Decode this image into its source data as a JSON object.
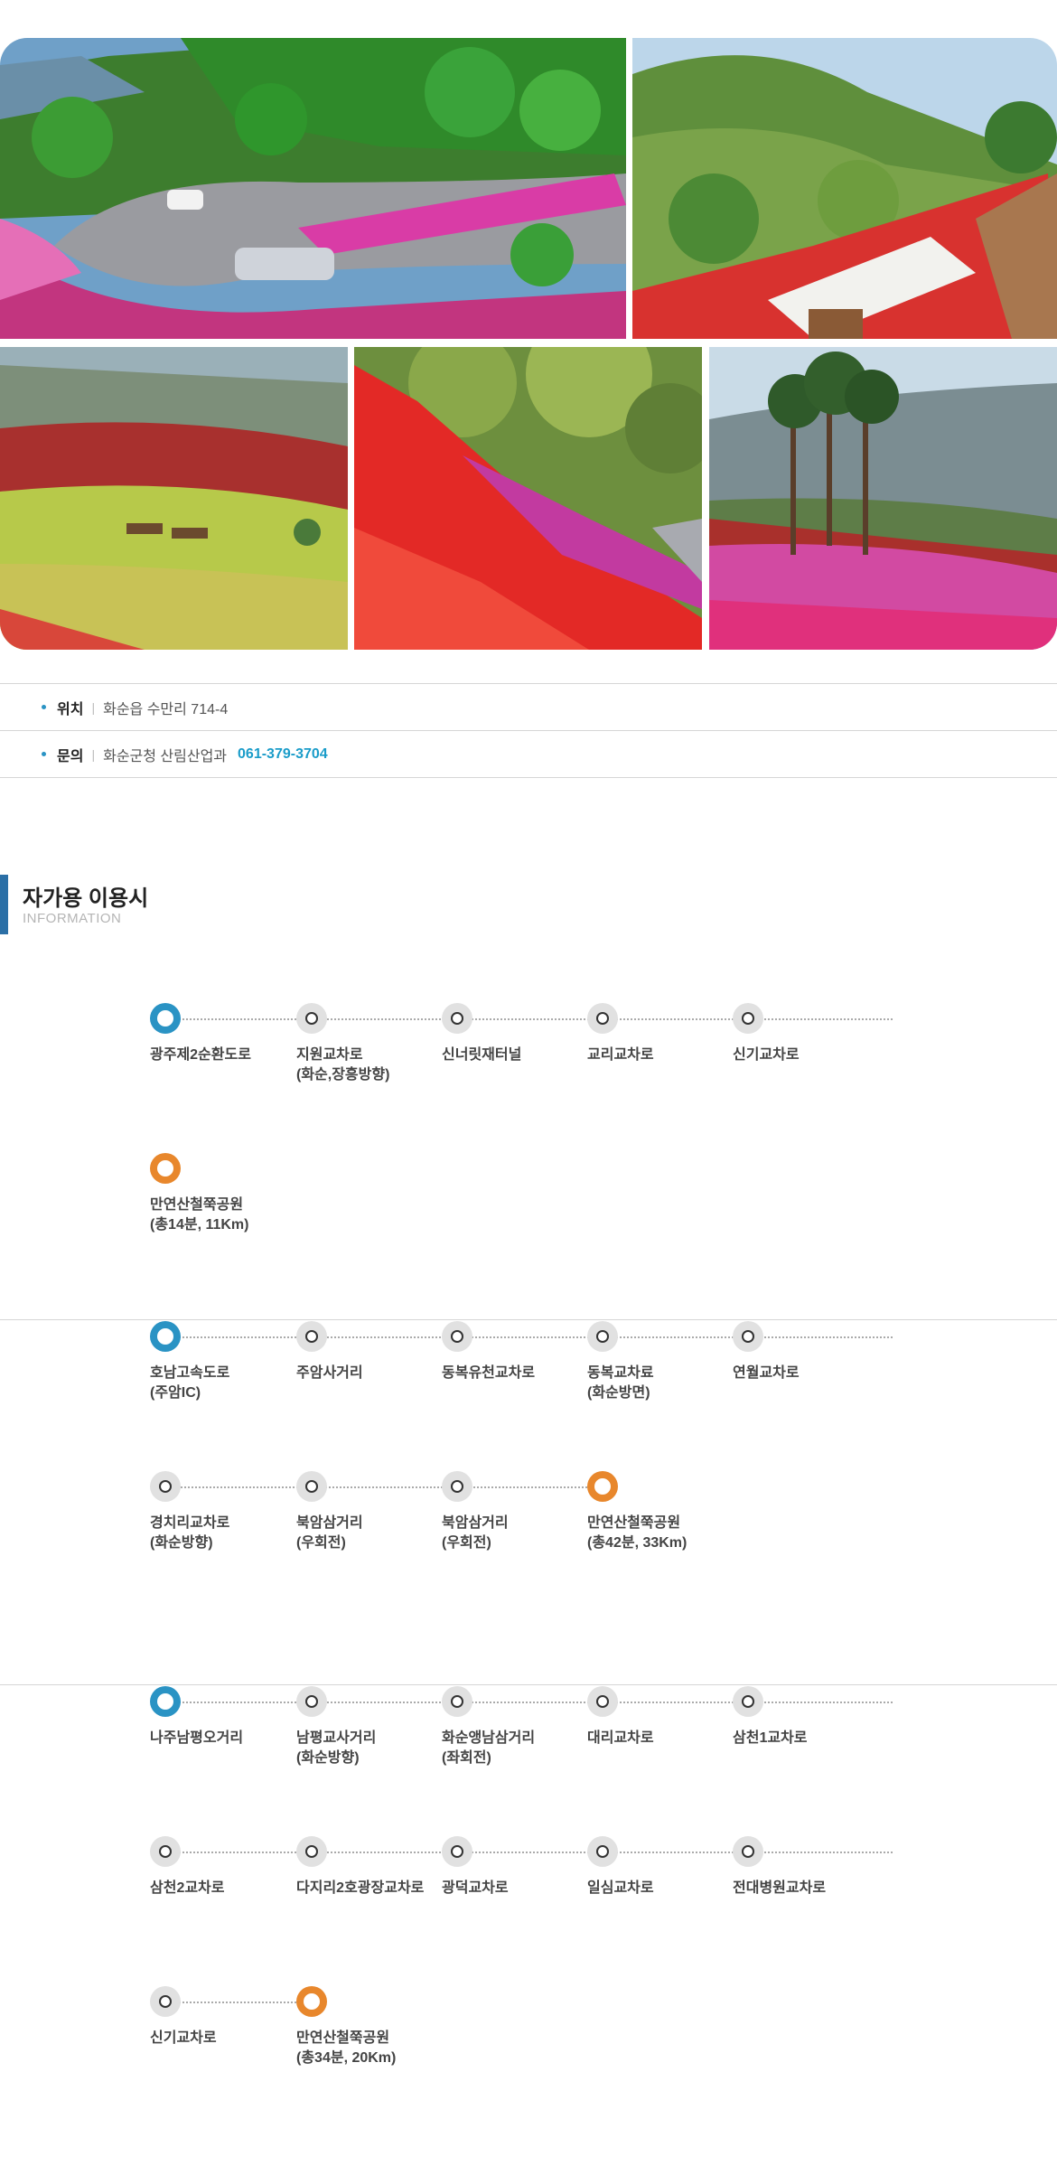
{
  "gallery": {
    "photos": [
      {
        "name": "azalea-road-photo"
      },
      {
        "name": "wooden-deck-photo"
      },
      {
        "name": "park-bench-photo"
      },
      {
        "name": "red-azalea-slope-photo"
      },
      {
        "name": "pine-tree-azalea-photo"
      }
    ]
  },
  "info": {
    "location": {
      "label": "위치",
      "value": "화순읍 수만리 714-4"
    },
    "contact": {
      "label": "문의",
      "value": "화순군청 산림산업과",
      "phone": "061-379-3704"
    }
  },
  "section": {
    "title": "자가용 이용시",
    "subtitle": "INFORMATION"
  },
  "colors": {
    "accent_blue": "#2a93c4",
    "accent_orange": "#e8872c",
    "heading_bar": "#2b6fa6"
  },
  "routes": [
    {
      "rows": [
        [
          {
            "type": "start",
            "lines": [
              "광주제2순환도로"
            ]
          },
          {
            "type": "normal",
            "lines": [
              "지원교차로",
              "(화순,장흥방향)"
            ]
          },
          {
            "type": "normal",
            "lines": [
              "신너릿재터널"
            ]
          },
          {
            "type": "normal",
            "lines": [
              "교리교차로"
            ]
          },
          {
            "type": "normal",
            "lines": [
              "신기교차로"
            ]
          }
        ],
        [
          {
            "type": "end",
            "lines": [
              "만연산철쭉공원",
              "(총14분, 11Km)"
            ]
          }
        ]
      ]
    },
    {
      "rows": [
        [
          {
            "type": "start",
            "lines": [
              "호남고속도로",
              "(주암IC)"
            ]
          },
          {
            "type": "normal",
            "lines": [
              "주암사거리"
            ]
          },
          {
            "type": "normal",
            "lines": [
              "동복유천교차로"
            ]
          },
          {
            "type": "normal",
            "lines": [
              "동복교차료",
              "(화순방면)"
            ]
          },
          {
            "type": "normal",
            "lines": [
              "연월교차로"
            ]
          }
        ],
        [
          {
            "type": "normal",
            "lines": [
              "경치리교차로",
              "(화순방향)"
            ]
          },
          {
            "type": "normal",
            "lines": [
              "북암삼거리",
              "(우회전)"
            ]
          },
          {
            "type": "normal",
            "lines": [
              "북암삼거리",
              "(우회전)"
            ]
          },
          {
            "type": "end",
            "lines": [
              "만연산철쭉공원",
              "(총42분, 33Km)"
            ]
          }
        ]
      ]
    },
    {
      "rows": [
        [
          {
            "type": "start",
            "lines": [
              "나주남평오거리"
            ]
          },
          {
            "type": "normal",
            "lines": [
              "남평교사거리",
              "(화순방향)"
            ]
          },
          {
            "type": "normal",
            "lines": [
              "화순앵남삼거리",
              "(좌회전)"
            ]
          },
          {
            "type": "normal",
            "lines": [
              "대리교차로"
            ]
          },
          {
            "type": "normal",
            "lines": [
              "삼천1교차로"
            ]
          }
        ],
        [
          {
            "type": "normal",
            "lines": [
              "삼천2교차로"
            ]
          },
          {
            "type": "normal",
            "lines": [
              "다지리2호광장교차로"
            ]
          },
          {
            "type": "normal",
            "lines": [
              "광덕교차로"
            ]
          },
          {
            "type": "normal",
            "lines": [
              "일심교차로"
            ]
          },
          {
            "type": "normal",
            "lines": [
              "전대병원교차로"
            ]
          }
        ],
        [
          {
            "type": "normal",
            "lines": [
              "신기교차로"
            ]
          },
          {
            "type": "end",
            "lines": [
              "만연산철쭉공원",
              "(총34분, 20Km)"
            ]
          }
        ]
      ]
    }
  ]
}
